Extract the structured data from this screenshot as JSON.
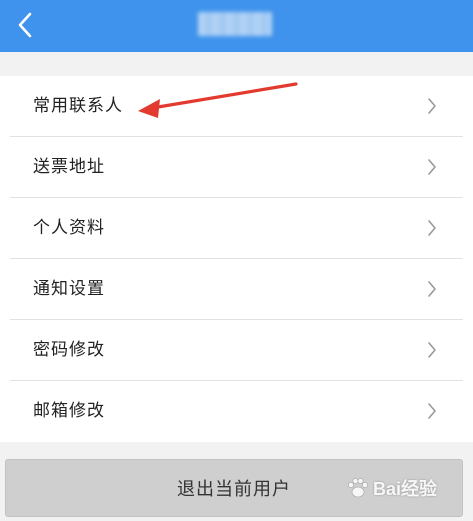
{
  "header": {
    "back_icon": "chevron-left-icon"
  },
  "menu": {
    "items": [
      {
        "label": "常用联系人"
      },
      {
        "label": "送票地址"
      },
      {
        "label": "个人资料"
      },
      {
        "label": "通知设置"
      },
      {
        "label": "密码修改"
      },
      {
        "label": "邮箱修改"
      }
    ],
    "chevron_icon": "chevron-right-icon"
  },
  "logout": {
    "label": "退出当前用户"
  },
  "watermark": {
    "text": "Bai经验"
  },
  "colors": {
    "header_bg": "#3f93ec",
    "annotation_arrow": "#e23a2e",
    "page_bg": "#f2f2f2",
    "logout_bg": "#cfcfcf"
  }
}
